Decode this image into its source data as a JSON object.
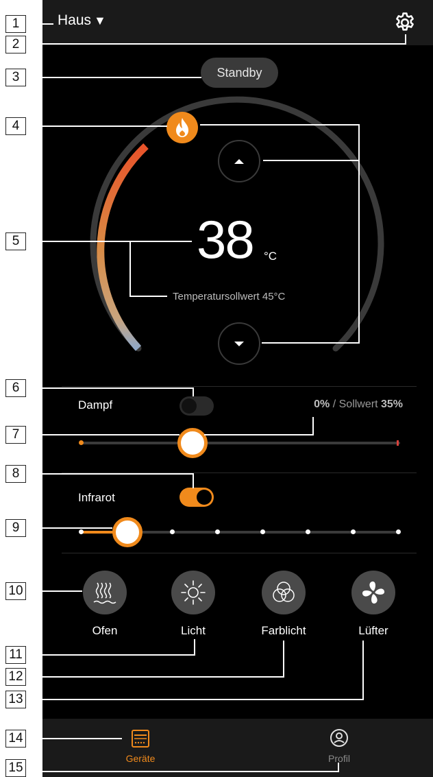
{
  "header": {
    "title": "Haus",
    "dropdown_icon": "caret-down-icon",
    "settings_icon": "gear-icon"
  },
  "status": {
    "mode_label": "Standby"
  },
  "thermostat": {
    "current_temp": "38",
    "unit": "°C",
    "setpoint_label": "Temperatursollwert 45°C",
    "heating_icon": "flame-icon",
    "up_icon": "arrow-up-icon",
    "down_icon": "arrow-down-icon",
    "accent_color": "#f08a1c"
  },
  "dampf": {
    "label": "Dampf",
    "enabled": false,
    "value_text": "0%",
    "separator": " / Sollwert ",
    "setpoint_text": "35%",
    "slider_level_percent": 35
  },
  "infrarot": {
    "label": "Infrarot",
    "enabled": true,
    "steps": 8,
    "selected_step": 2
  },
  "devices": [
    {
      "label": "Ofen",
      "icon": "heater-icon"
    },
    {
      "label": "Licht",
      "icon": "sun-icon"
    },
    {
      "label": "Farblicht",
      "icon": "color-circles-icon"
    },
    {
      "label": "Lüfter",
      "icon": "fan-icon"
    }
  ],
  "nav": [
    {
      "label": "Geräte",
      "icon": "device-panel-icon",
      "active": true
    },
    {
      "label": "Profil",
      "icon": "profile-icon",
      "active": false
    }
  ],
  "callouts": [
    "1",
    "2",
    "3",
    "4",
    "5",
    "6",
    "7",
    "8",
    "9",
    "10",
    "11",
    "12",
    "13",
    "14",
    "15"
  ]
}
